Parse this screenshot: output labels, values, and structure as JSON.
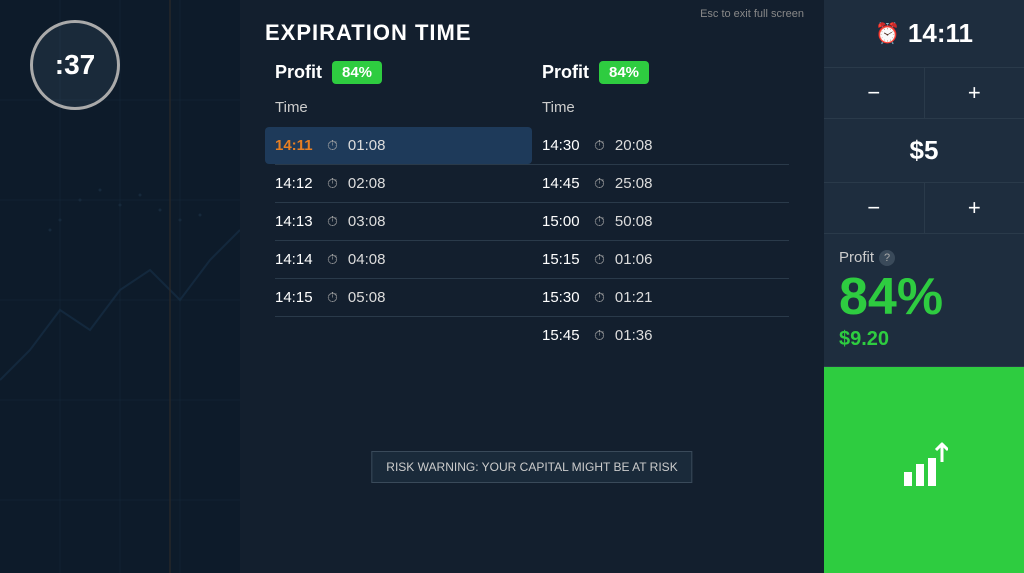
{
  "left": {
    "timer_value": ":37"
  },
  "center": {
    "title": "EXPIRATION TIME",
    "esc_hint": "Esc to exit full screen",
    "profit_left": {
      "label": "Profit",
      "badge": "84%"
    },
    "profit_right": {
      "label": "Profit",
      "badge": "84%"
    },
    "time_col_label": "Time",
    "time_col_label2": "Time",
    "rows": [
      {
        "time": "14:11",
        "duration": "01:08",
        "selected": true,
        "orange": true
      },
      {
        "time": "14:12",
        "duration": "02:08",
        "selected": false,
        "orange": false
      },
      {
        "time": "14:13",
        "duration": "03:08",
        "selected": false,
        "orange": false
      },
      {
        "time": "14:14",
        "duration": "04:08",
        "selected": false,
        "orange": false
      },
      {
        "time": "14:15",
        "duration": "05:08",
        "selected": false,
        "orange": false
      }
    ],
    "rows_right": [
      {
        "time": "14:30",
        "duration": "20:08"
      },
      {
        "time": "14:45",
        "duration": "25:08"
      },
      {
        "time": "15:00",
        "duration": "50:08"
      },
      {
        "time": "15:15",
        "duration": "01:06"
      },
      {
        "time": "15:30",
        "duration": "01:21"
      },
      {
        "time": "15:45",
        "duration": "01:36"
      }
    ],
    "risk_warning": "RISK WARNING: YOUR CAPITAL MIGHT BE AT RISK"
  },
  "right": {
    "time_value": "14:11",
    "clock_symbol": "⏰",
    "minus1": "−",
    "plus1": "+",
    "amount": "$5",
    "minus2": "−",
    "plus2": "+",
    "profit_label": "Profit",
    "help_symbol": "?",
    "profit_percent": "84%",
    "profit_amount": "$9.20"
  }
}
